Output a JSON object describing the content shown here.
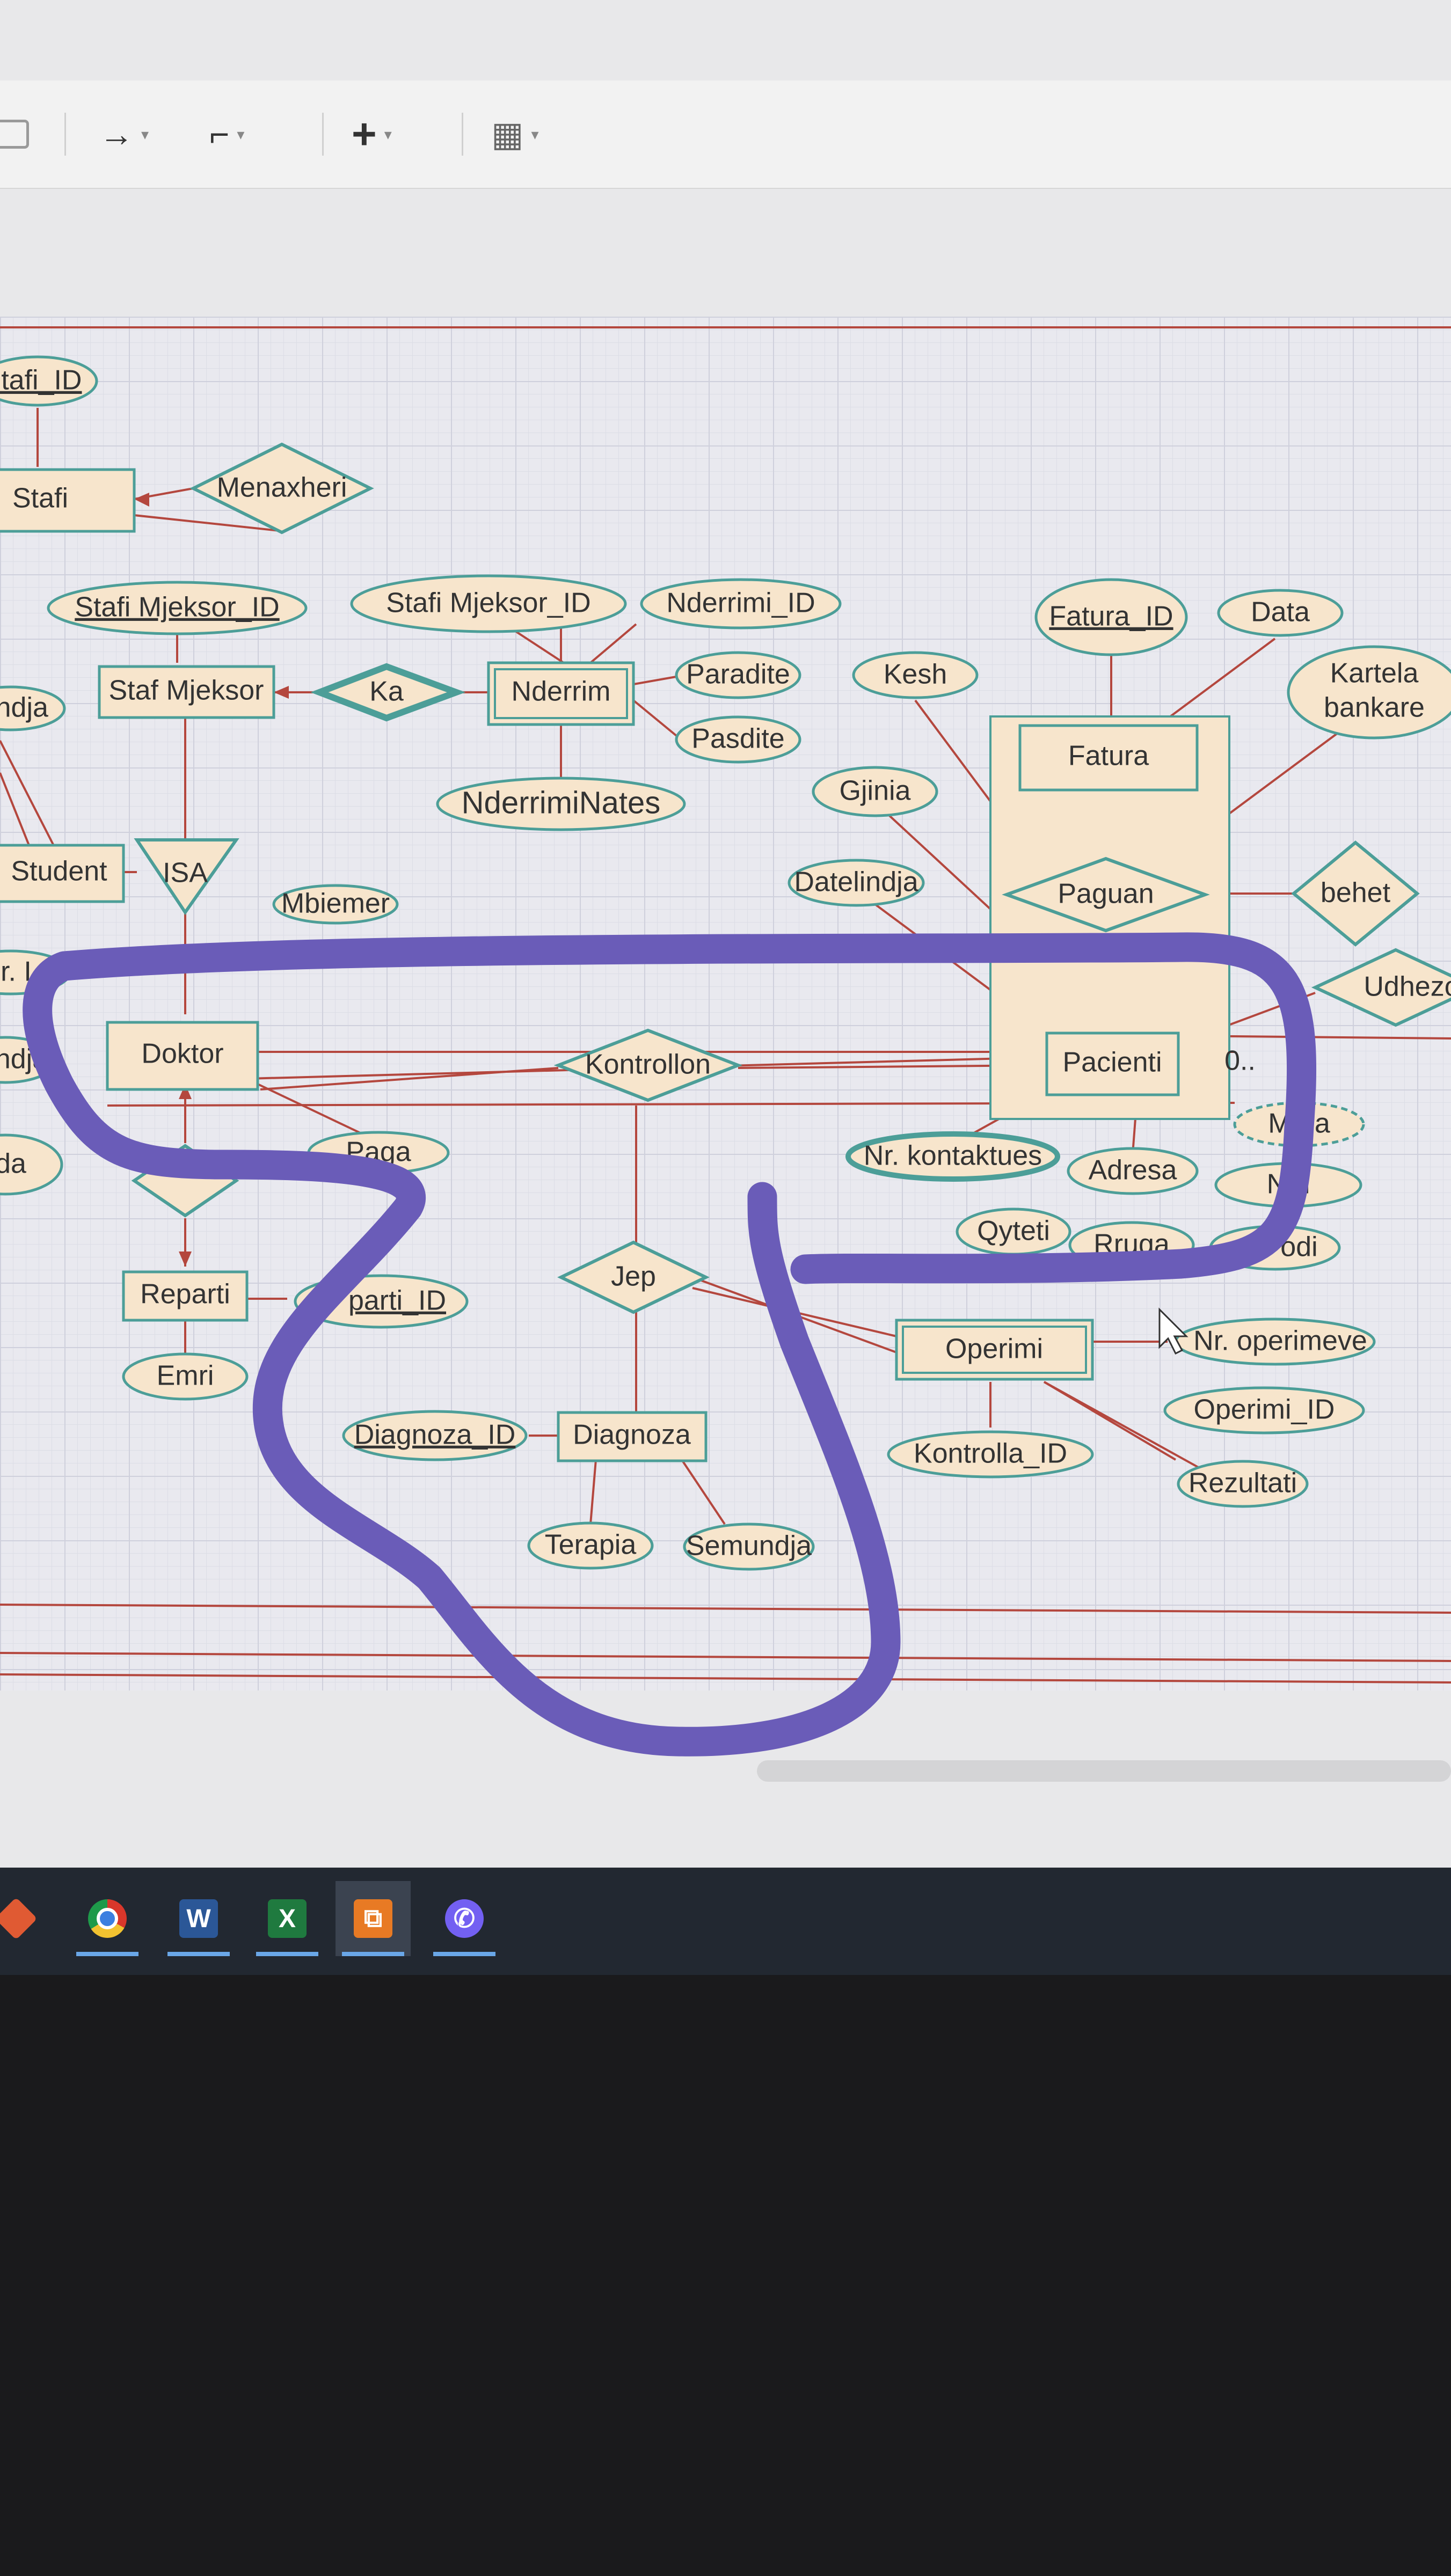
{
  "toolbar": {
    "arrow_icon": "→",
    "waypoint_icon": "⌐",
    "plus_icon": "+",
    "table_icon": "▦",
    "caret": "▾"
  },
  "colors": {
    "entity_fill": "#f7e5cc",
    "border": "#4c9e98",
    "line": "#b4473e",
    "marker": "#6a5cb8"
  },
  "diagram": {
    "stafi_id": "Stafi_ID",
    "stafi": "Stafi",
    "menaxheri": "Menaxheri",
    "stafi_mjeksor_id_1": "Stafi Mjeksor_ID",
    "stafi_mjeksor_id_2": "Stafi Mjeksor_ID",
    "nderrimi_id": "Nderrimi_ID",
    "staf_mjeksor": "Staf Mjeksor",
    "ka": "Ka",
    "nderrim": "Nderrim",
    "paradite": "Paradite",
    "pasdite": "Pasdite",
    "nderrimi_nates": "NderrimiNates",
    "datelindja_left": "indja",
    "student": "Student",
    "isa": "ISA",
    "mbiemer": "Mbiemer",
    "nr_left": "r. I",
    "ndja": "ndja",
    "da": "da",
    "doktor": "Doktor",
    "paga": "Paga",
    "reparti": "Reparti",
    "reparti_id": "parti_ID",
    "emri": "Emri",
    "kontrollon": "Kontrollon",
    "jep": "Jep",
    "diagnoza_id": "Diagnoza_ID",
    "diagnoza": "Diagnoza",
    "terapia": "Terapia",
    "semundja": "Semundja",
    "fatura_id": "Fatura_ID",
    "data": "Data",
    "kesh": "Kesh",
    "kartela": "Kartela",
    "bankare": "bankare",
    "fatura": "Fatura",
    "gjinia": "Gjinia",
    "datelindja": "Datelindja",
    "paguan": "Paguan",
    "behet": "behet",
    "udhezo": "Udhezo",
    "pacienti": "Pacienti",
    "card": "0..",
    "nr_kontaktues": "Nr. kontaktues",
    "adresa": "Adresa",
    "mosha": "M     na",
    "numri": "N     ri",
    "qyteti": "Qyteti",
    "rruga": "Rruga",
    "kodi": "odi",
    "operimi": "Operimi",
    "nr_operimeve": "Nr. operimeve",
    "operimi_id": "Operimi_ID",
    "kontrolla_id": "Kontrolla_ID",
    "rezultati": "Rezultati"
  },
  "taskbar": [
    {
      "name": "git-app-icon",
      "glyph": "◆",
      "color": "#e05a33"
    },
    {
      "name": "chrome-icon",
      "glyph": "●",
      "color": "#d9a31e"
    },
    {
      "name": "word-icon",
      "glyph": "W",
      "color": "#2b5797"
    },
    {
      "name": "excel-icon",
      "glyph": "X",
      "color": "#1f7a3f"
    },
    {
      "name": "drawio-icon",
      "glyph": "⧉",
      "color": "#e87a24"
    },
    {
      "name": "viber-icon",
      "glyph": "✆",
      "color": "#7360f2"
    }
  ]
}
